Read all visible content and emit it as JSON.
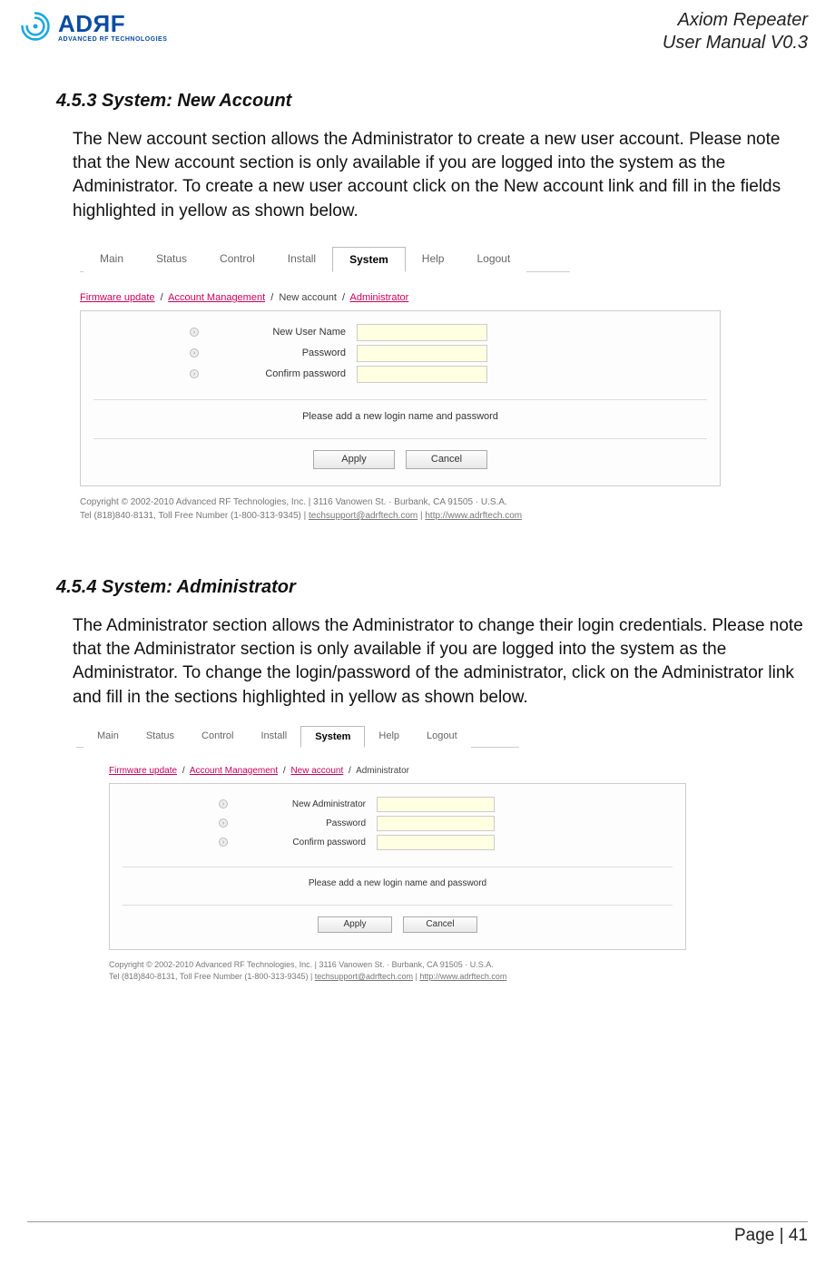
{
  "header": {
    "logo_main": "ADЯF",
    "logo_sub": "ADVANCED RF TECHNOLOGIES",
    "title_line1": "Axiom Repeater",
    "title_line2": "User Manual V0.3"
  },
  "section1": {
    "heading": "4.5.3 System: New Account",
    "para": "The New account section allows the Administrator to create a new user account.  Please note that the New account section is only available if you are logged into the system as the Administrator.    To create a new user account click on the New account link and fill in the fields highlighted in yellow as shown below."
  },
  "screenshot1": {
    "tabs": [
      "Main",
      "Status",
      "Control",
      "Install",
      "System",
      "Help",
      "Logout"
    ],
    "active_tab_index": 4,
    "breadcrumb": {
      "items": [
        {
          "text": "Firmware update",
          "link": true
        },
        {
          "text": "Account Management",
          "link": true
        },
        {
          "text": "New account",
          "link": false
        },
        {
          "text": "Administrator",
          "link": true
        }
      ]
    },
    "fields": {
      "f1": "New User Name",
      "f2": "Password",
      "f3": "Confirm password"
    },
    "msg": "Please add a new login name and password",
    "apply": "Apply",
    "cancel": "Cancel",
    "footer1": "Copyright © 2002-2010 Advanced RF Technologies, Inc. | 3116 Vanowen St. · Burbank, CA 91505 · U.S.A.",
    "footer2a": "Tel (818)840-8131, Toll Free Number (1-800-313-9345) | ",
    "footer2b": "techsupport@adrftech.com",
    "footer2c": " | ",
    "footer2d": "http://www.adrftech.com"
  },
  "section2": {
    "heading": "4.5.4 System: Administrator",
    "para": "The Administrator section allows the Administrator to change their login credentials.  Please note that the Administrator section is only available if you are logged into the system as the Administrator.    To change the login/password of the administrator, click on the Administrator link and fill in the sections highlighted in yellow as shown below."
  },
  "screenshot2": {
    "tabs": [
      "Main",
      "Status",
      "Control",
      "Install",
      "System",
      "Help",
      "Logout"
    ],
    "active_tab_index": 4,
    "breadcrumb": {
      "items": [
        {
          "text": "Firmware update",
          "link": true
        },
        {
          "text": "Account Management",
          "link": true
        },
        {
          "text": "New account",
          "link": true
        },
        {
          "text": "Administrator",
          "link": false
        }
      ]
    },
    "fields": {
      "f1": "New Administrator",
      "f2": "Password",
      "f3": "Confirm password"
    },
    "msg": "Please add a new login name and password",
    "apply": "Apply",
    "cancel": "Cancel",
    "footer1": "Copyright © 2002-2010 Advanced RF Technologies, Inc. | 3116 Vanowen St. · Burbank, CA 91505 · U.S.A.",
    "footer2a": "Tel (818)840-8131, Toll Free Number (1-800-313-9345) | ",
    "footer2b": "techsupport@adrftech.com",
    "footer2c": " | ",
    "footer2d": "http://www.adrftech.com"
  },
  "page_footer": "Page | 41"
}
